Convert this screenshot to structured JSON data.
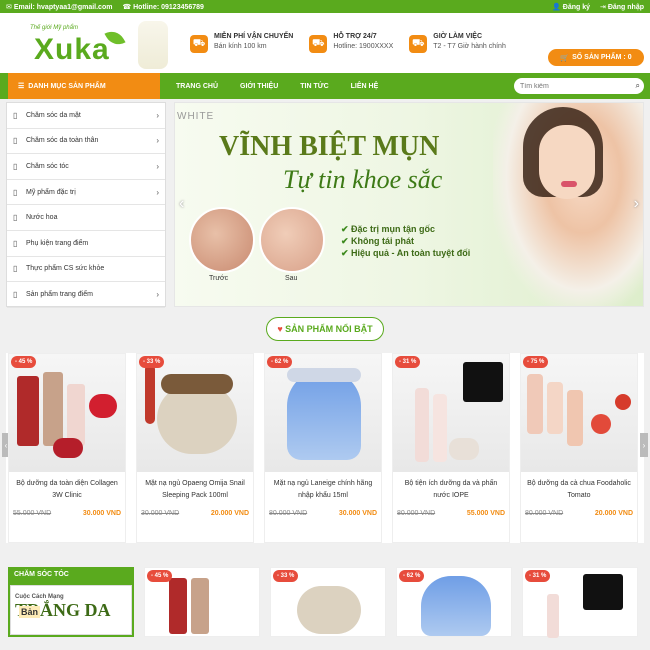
{
  "topbar": {
    "email": "Email: hvaptyaa1@gmail.com",
    "hotline": "Hotline: 09123456789",
    "register": "Đăng ký",
    "login": "Đăng nhập"
  },
  "logo": {
    "tagline": "Thế giới Mỹ phẩm",
    "brand": "Xuka"
  },
  "features": [
    {
      "title": "MIỄN PHÍ VẬN CHUYỂN",
      "sub": "Bán kính 100 km",
      "icon": "truck-icon"
    },
    {
      "title": "HỖ TRỢ 24/7",
      "sub": "Hotline: 1900XXXX",
      "icon": "support-icon"
    },
    {
      "title": "GIỜ LÀM VIỆC",
      "sub": "T2 - T7 Giờ hành chính",
      "icon": "clock-icon"
    }
  ],
  "cart": {
    "label": "SỐ SẢN PHẨM : 0"
  },
  "nav": {
    "category_button": "DANH MỤC SẢN PHẨM",
    "links": [
      "TRANG CHỦ",
      "GIỚI THIỆU",
      "TIN TỨC",
      "LIÊN HỆ"
    ],
    "search_placeholder": "Tìm kiếm"
  },
  "categories": [
    {
      "label": "Chăm sóc da mặt",
      "arrow": true
    },
    {
      "label": "Chăm sóc da toàn thân",
      "arrow": true
    },
    {
      "label": "Chăm sóc tóc",
      "arrow": true
    },
    {
      "label": "Mỹ phẩm đặc trị",
      "arrow": true
    },
    {
      "label": "Nước hoa",
      "arrow": false
    },
    {
      "label": "Phụ kiện trang điểm",
      "arrow": false
    },
    {
      "label": "Thực phẩm CS sức khỏe",
      "arrow": false
    },
    {
      "label": "Sản phẩm trang điểm",
      "arrow": true
    }
  ],
  "banner": {
    "brand": "WHITE",
    "headline": "VĨNH BIỆT MỤN",
    "subheadline": "Tự tin khoe sắc",
    "before": "Trước",
    "after": "Sau",
    "bullets": [
      "Đặc trị mụn tận gốc",
      "Không tái phát",
      "Hiệu quả - An toàn tuyệt đối"
    ]
  },
  "section_title": "SẢN PHẨM NỔI BẬT",
  "products": [
    {
      "badge": "- 45 %",
      "name": "Bộ dưỡng da toàn diện Collagen 3W Clinic",
      "old": "55.000 VND",
      "new": "30.000 VND"
    },
    {
      "badge": "- 33 %",
      "name": "Mặt nạ ngủ Opaeng Omija Snail Sleeping Pack 100ml",
      "old": "30.000 VND",
      "new": "20.000 VND"
    },
    {
      "badge": "- 62 %",
      "name": "Mặt nạ ngủ Laneige chính hãng nhập khẩu 15ml",
      "old": "80.000 VND",
      "new": "30.000 VND"
    },
    {
      "badge": "- 31 %",
      "name": "Bộ tiện ích dưỡng da và phấn nước IOPE",
      "old": "80.000 VND",
      "new": "55.000 VND"
    },
    {
      "badge": "- 75 %",
      "name": "Bộ dưỡng da cà chua Foodaholic Tomato",
      "old": "80.000 VND",
      "new": "20.000 VND"
    }
  ],
  "bottom": {
    "title": "CHĂM SÓC TÓC",
    "promo_caption": "Cuộc Cách Mạng",
    "promo_big": "TRẮNG DA",
    "promo_ban": "Bản",
    "thumb_badges": [
      "- 45 %",
      "- 33 %",
      "- 62 %",
      "- 31 %"
    ]
  }
}
